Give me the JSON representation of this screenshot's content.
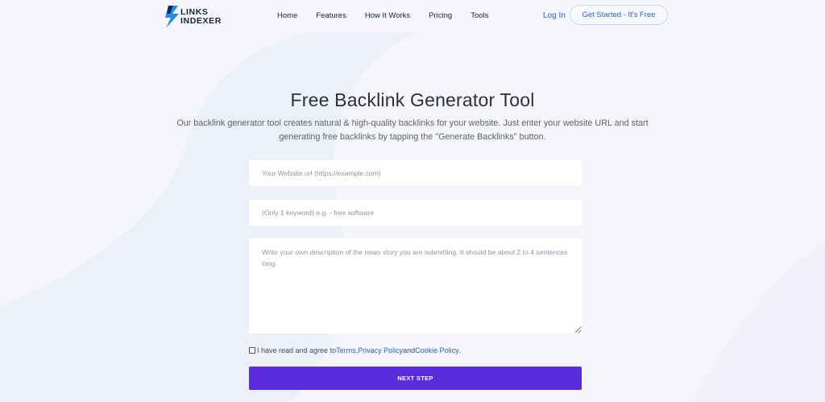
{
  "brand": {
    "logo_line1": "LINKS",
    "logo_line2": "INDEXER",
    "logo_icon": "lightning-bolt-icon"
  },
  "nav": {
    "items": [
      {
        "label": "Home"
      },
      {
        "label": "Features"
      },
      {
        "label": "How It Works"
      },
      {
        "label": "Pricing"
      },
      {
        "label": "Tools"
      }
    ],
    "login_label": "Log In",
    "cta_label": "Get Started - It's Free"
  },
  "hero": {
    "title": "Free Backlink Generator Tool",
    "subtitle_line1": "Our backlink generator tool creates natural & high-quality backlinks for your website. Just enter your website URL and start",
    "subtitle_line2": "generating free backlinks by tapping the \"Generate Backlinks\" button."
  },
  "form": {
    "url_placeholder": "Your Website url (https://example.com)",
    "url_value": "",
    "keyword_placeholder": "(Only 1 keyword) e.g. - free software",
    "keyword_value": "",
    "description_placeholder": "Write your own description of the news story you are submitting. It should be about 2 to 4 sentences long.",
    "description_value": "",
    "agree": {
      "checked": false,
      "prefix": "I have read and agree to ",
      "terms": "Terms",
      "sep1": ", ",
      "privacy": "Privacy Policy",
      "sep2": " and ",
      "cookie": "Cookie Policy",
      "suffix": "."
    },
    "submit_label": "NEXT STEP"
  },
  "colors": {
    "accent": "#5b2be0",
    "link": "#2b63c8",
    "background": "#f5f6fb",
    "logo_blue": "#1f8fe6"
  }
}
